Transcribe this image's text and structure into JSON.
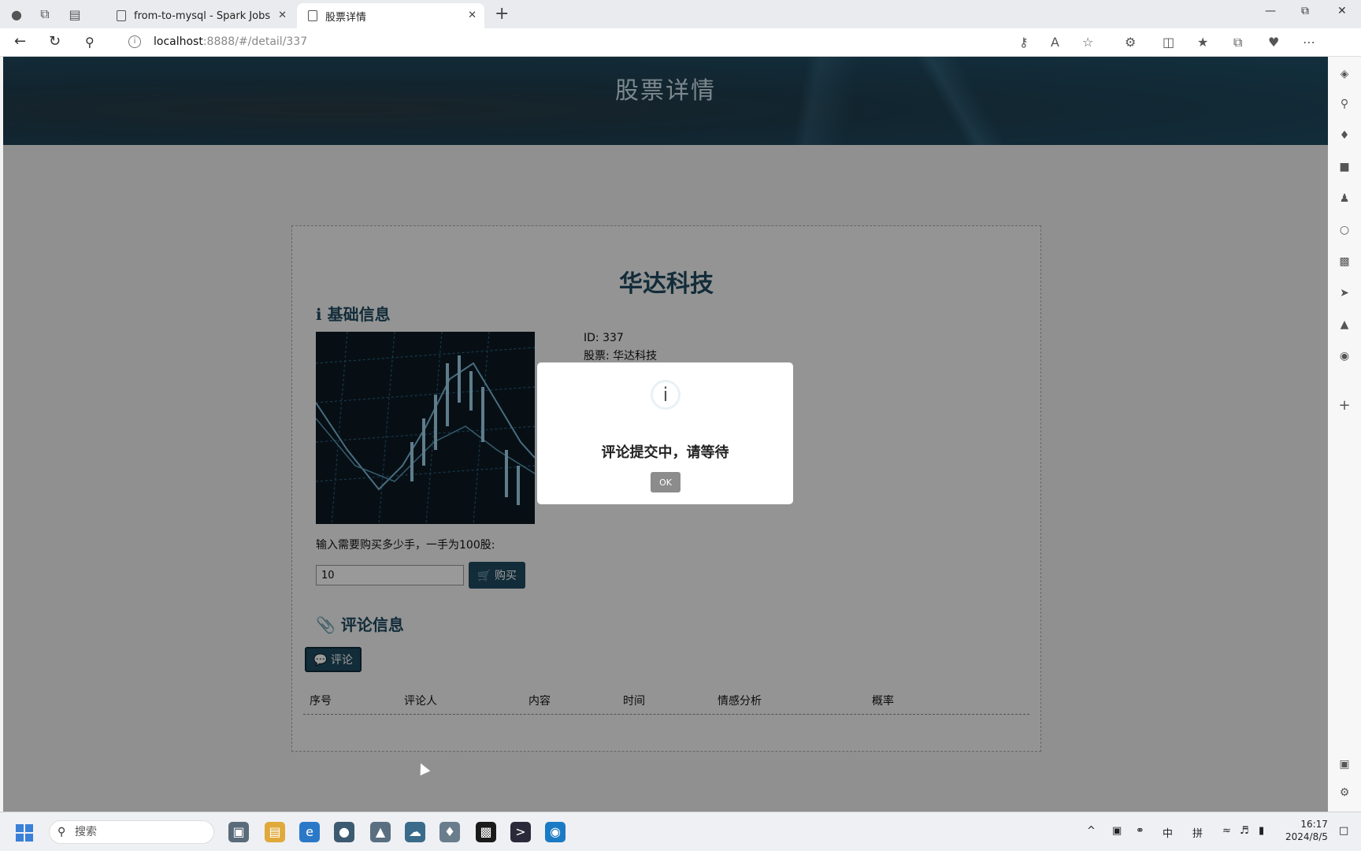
{
  "browser": {
    "tabs": [
      {
        "title": "from-to-mysql - Spark Jobs",
        "active": false
      },
      {
        "title": "股票详情",
        "active": true
      }
    ],
    "url_host": "localhost",
    "url_path": ":8888/#/detail/337"
  },
  "page": {
    "banner_title": "股票详情",
    "stock_name": "华达科技",
    "basic_info_title": "基础信息",
    "id_label": "ID: 337",
    "stock_label": "股票: 华达科技",
    "buy_hint": "输入需要购买多少手，一手为100股:",
    "quantity_value": "10",
    "buy_button": "购买",
    "comment_section_title": "评论信息",
    "comment_button": "评论",
    "table_headers": [
      "序号",
      "评论人",
      "内容",
      "时间",
      "情感分析",
      "概率"
    ]
  },
  "dialog": {
    "icon": "i",
    "message": "评论提交中，请等待",
    "ok_label": "OK"
  },
  "taskbar": {
    "search_placeholder": "搜索",
    "ime_lang": "中",
    "ime_mode": "拼",
    "time": "16:17",
    "date": "2024/8/5"
  },
  "colors": {
    "accent": "#1f4a60",
    "banner": "#1d3f50",
    "overlay": "rgba(0,0,0,0.4)"
  }
}
